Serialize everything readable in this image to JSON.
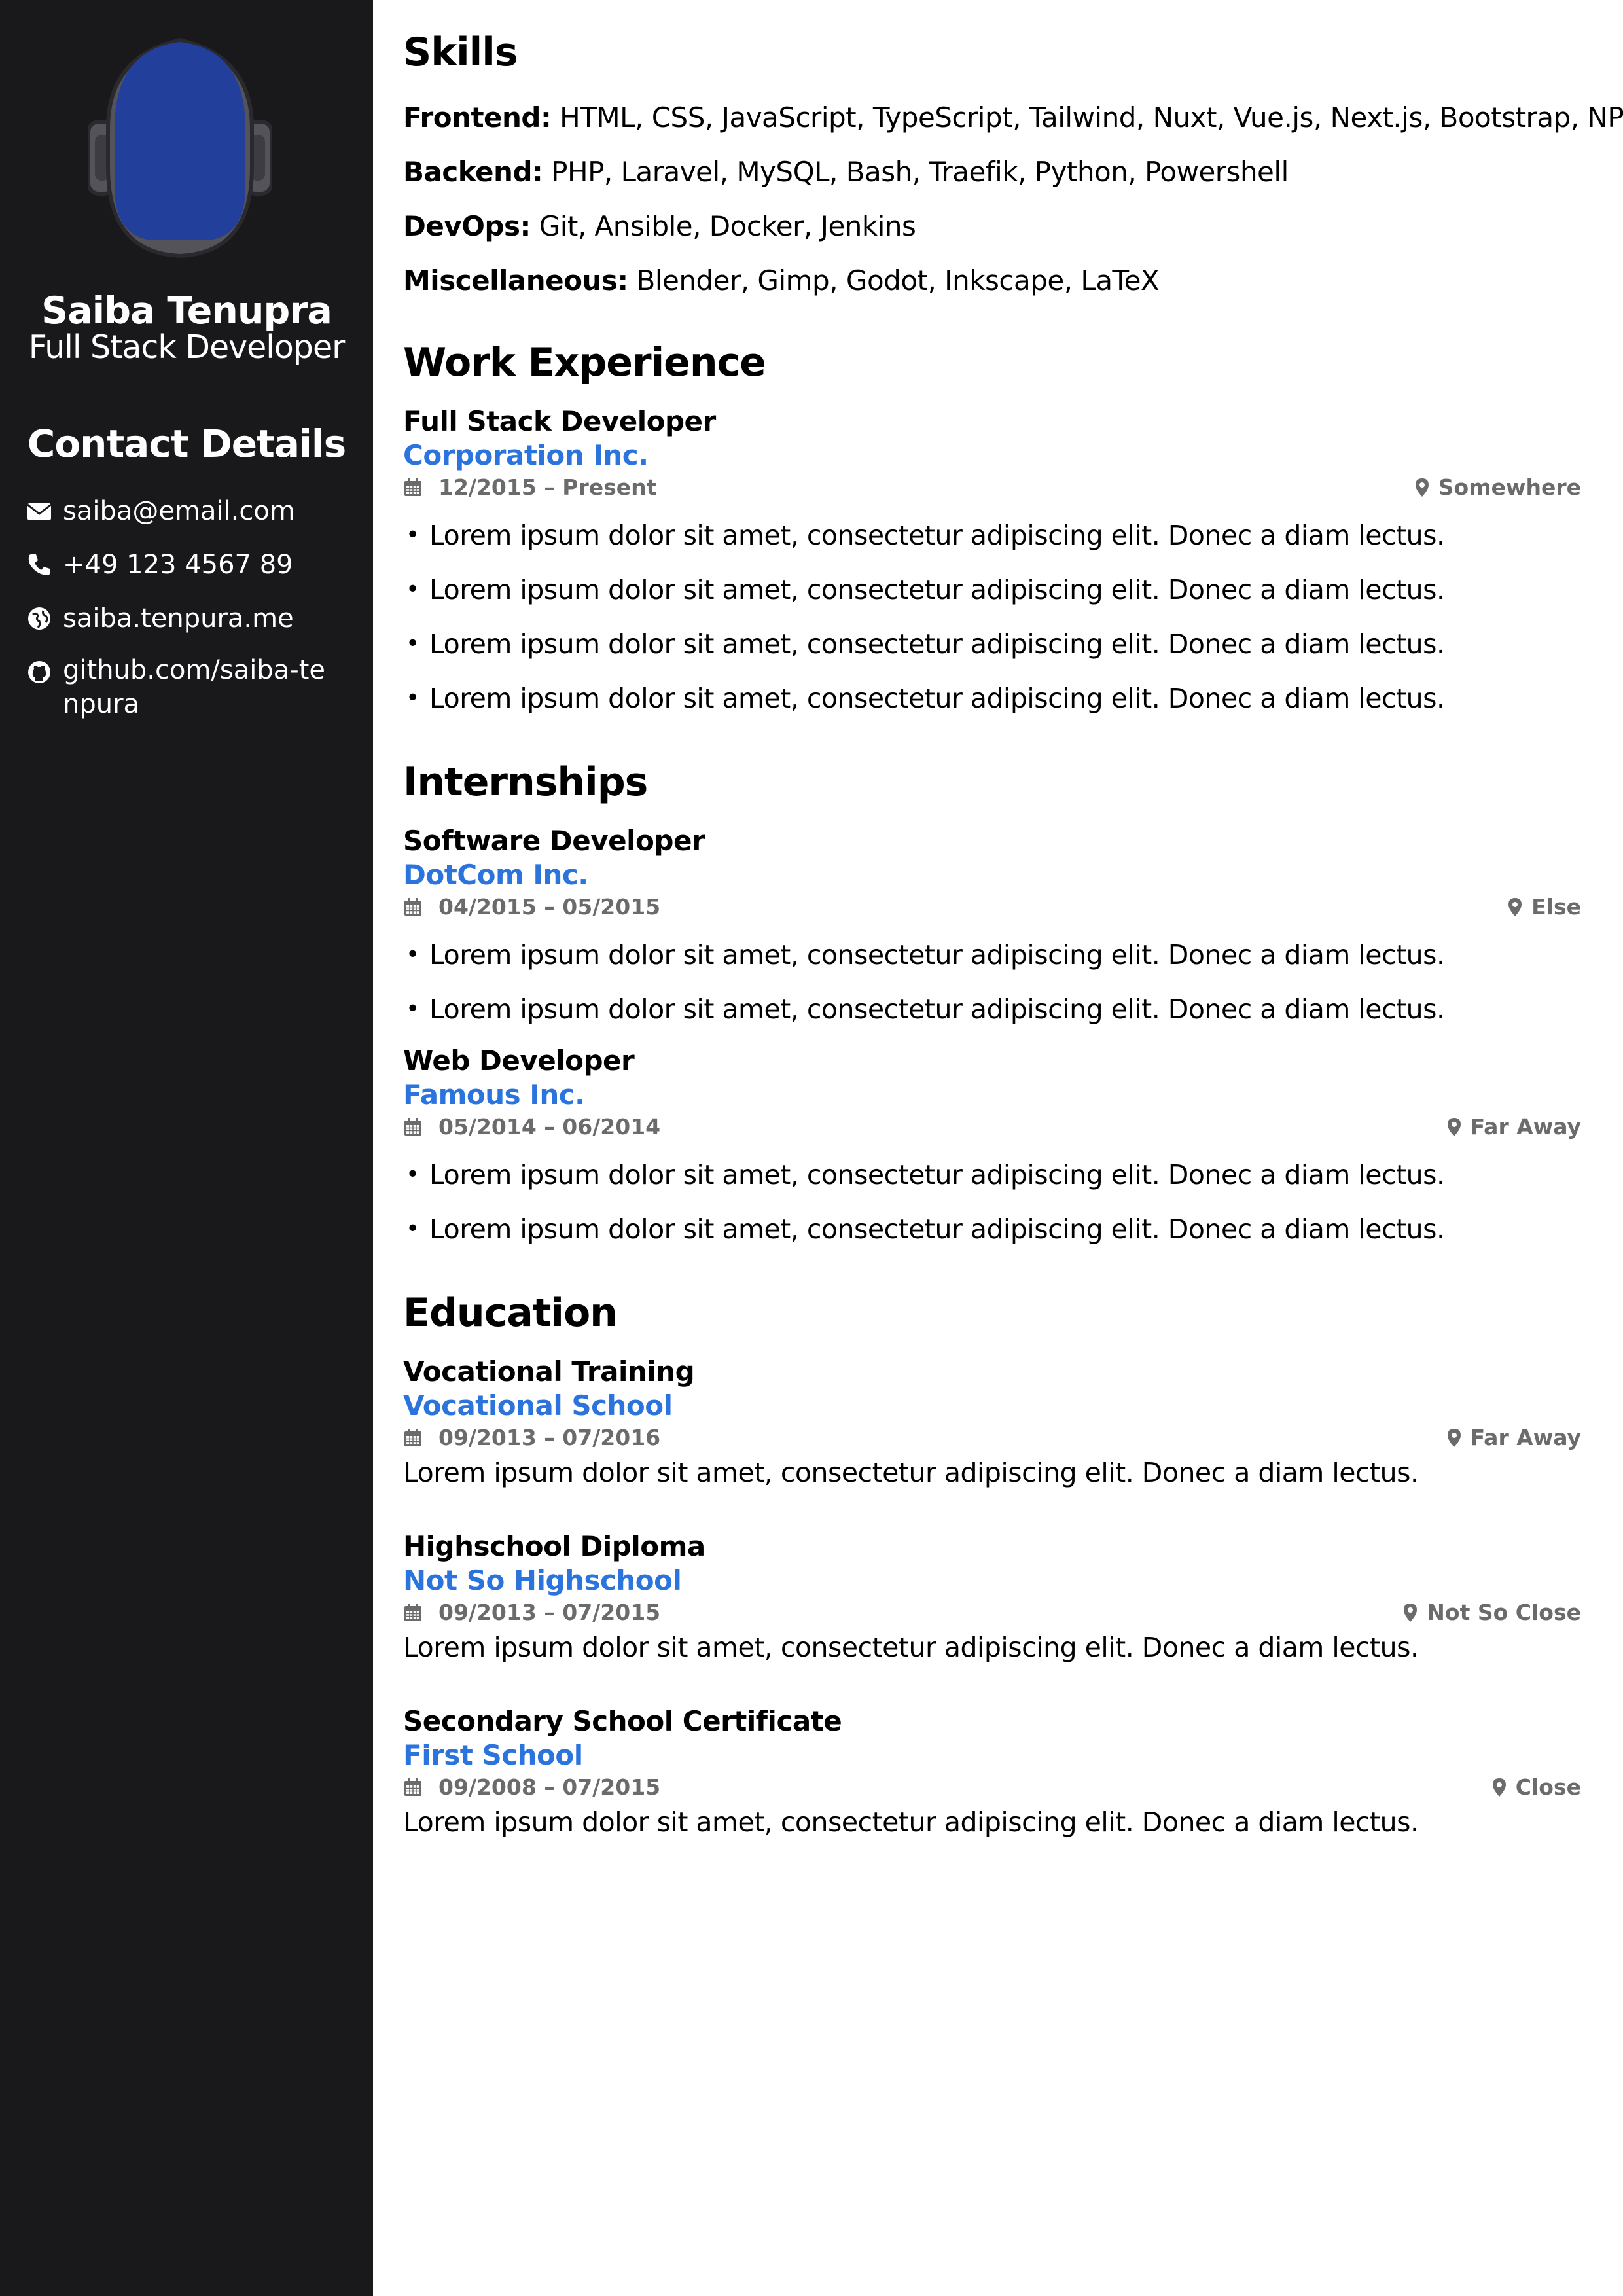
{
  "profile": {
    "name": "Saiba Tenupra",
    "role": "Full Stack Developer",
    "avatar_colors": {
      "face": "#213f9b",
      "helmet": "#54535a",
      "outline": "#2a2a2e"
    }
  },
  "contact": {
    "title": "Contact Details",
    "items": [
      {
        "icon": "envelope-icon",
        "text": "saiba@email.com"
      },
      {
        "icon": "phone-icon",
        "text": "+49 123 4567 89"
      },
      {
        "icon": "globe-icon",
        "text": "saiba.tenpura.me"
      },
      {
        "icon": "github-icon",
        "text": "github.com/saiba-tenpura"
      }
    ]
  },
  "skills": {
    "title": "Skills",
    "items": [
      {
        "label": "Frontend:",
        "value": "HTML, CSS, JavaScript, TypeScript, Tailwind, Nuxt, Vue.js, Next.js, Bootstrap, NPM"
      },
      {
        "label": "Backend:",
        "value": "PHP, Laravel, MySQL, Bash, Traefik, Python, Powershell"
      },
      {
        "label": "DevOps:",
        "value": "Git, Ansible, Docker, Jenkins"
      },
      {
        "label": "Miscellaneous:",
        "value": "Blender, Gimp, Godot, Inkscape, LaTeX"
      }
    ]
  },
  "work": {
    "title": "Work Experience",
    "entries": [
      {
        "title": "Full Stack Developer",
        "org": "Corporation Inc.",
        "date": "12/2015 – Present",
        "location": "Somewhere",
        "bullets": [
          "Lorem ipsum dolor sit amet, consectetur adipiscing elit. Donec a diam lectus.",
          "Lorem ipsum dolor sit amet, consectetur adipiscing elit. Donec a diam lectus.",
          "Lorem ipsum dolor sit amet, consectetur adipiscing elit. Donec a diam lectus.",
          "Lorem ipsum dolor sit amet, consectetur adipiscing elit. Donec a diam lectus."
        ]
      }
    ]
  },
  "internships": {
    "title": "Internships",
    "entries": [
      {
        "title": "Software Developer",
        "org": "DotCom Inc.",
        "date": "04/2015 – 05/2015",
        "location": "Else",
        "bullets": [
          "Lorem ipsum dolor sit amet, consectetur adipiscing elit. Donec a diam lectus.",
          "Lorem ipsum dolor sit amet, consectetur adipiscing elit. Donec a diam lectus."
        ]
      },
      {
        "title": "Web Developer",
        "org": "Famous Inc.",
        "date": "05/2014 – 06/2014",
        "location": "Far Away",
        "bullets": [
          "Lorem ipsum dolor sit amet, consectetur adipiscing elit. Donec a diam lectus.",
          "Lorem ipsum dolor sit amet, consectetur adipiscing elit. Donec a diam lectus."
        ]
      }
    ]
  },
  "education": {
    "title": "Education",
    "entries": [
      {
        "title": "Vocational Training",
        "org": "Vocational School",
        "date": "09/2013 – 07/2016",
        "location": "Far Away",
        "description": "Lorem ipsum dolor sit amet, consectetur adipiscing elit. Donec a diam lectus."
      },
      {
        "title": "Highschool Diploma",
        "org": "Not So Highschool",
        "date": "09/2013 – 07/2015",
        "location": "Not So Close",
        "description": "Lorem ipsum dolor sit amet, consectetur adipiscing elit. Donec a diam lectus."
      },
      {
        "title": "Secondary School Certificate",
        "org": "First School",
        "date": "09/2008 – 07/2015",
        "location": "Close",
        "description": "Lorem ipsum dolor sit amet, consectetur adipiscing elit. Donec a diam lectus."
      }
    ]
  },
  "colors": {
    "sidebar": "#19191b",
    "accent": "#2b73dd",
    "meta": "#6b6b6b"
  }
}
